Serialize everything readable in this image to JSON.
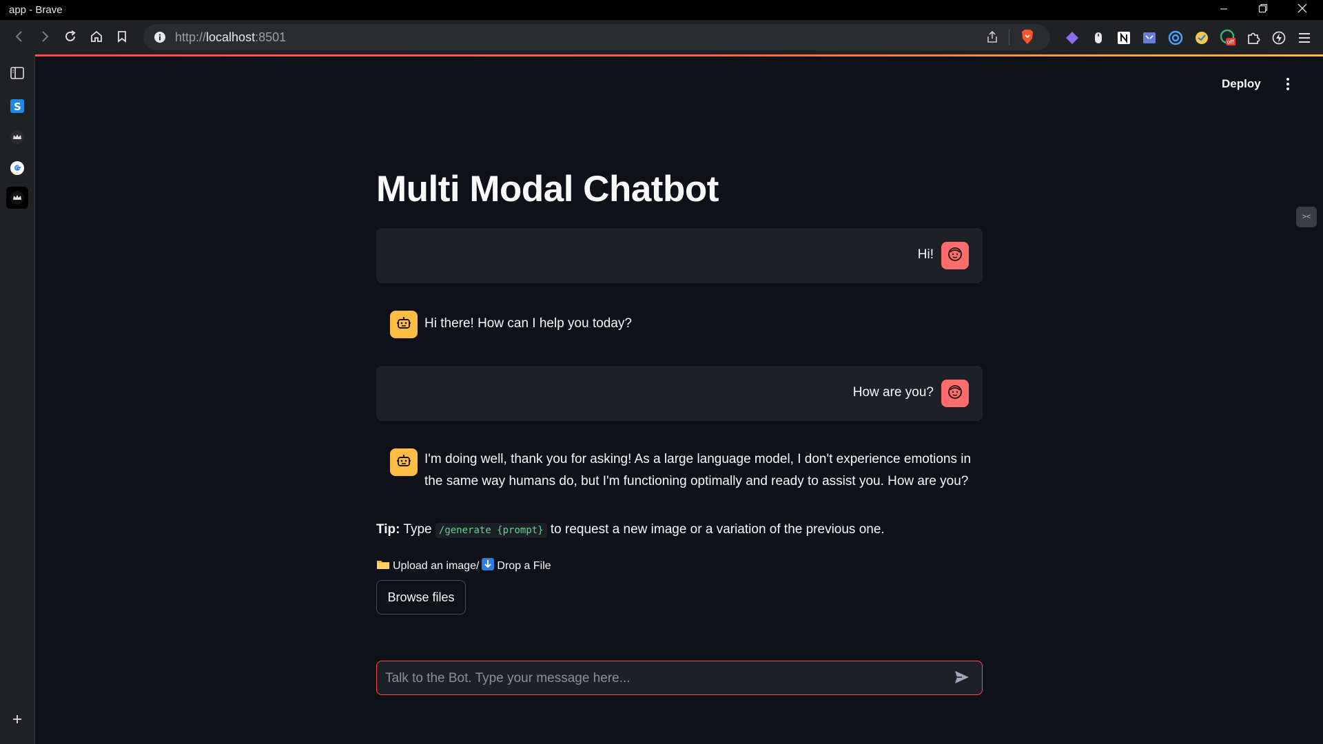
{
  "window": {
    "title": "app - Brave"
  },
  "browser": {
    "url_scheme": "http://",
    "url_host": "localhost",
    "url_port": ":8501"
  },
  "app": {
    "deploy_label": "Deploy",
    "title": "Multi Modal Chatbot",
    "messages": [
      {
        "role": "user",
        "text": "Hi!"
      },
      {
        "role": "assistant",
        "text": "Hi there! How can I help you today?"
      },
      {
        "role": "user",
        "text": "How are you?"
      },
      {
        "role": "assistant",
        "line1": "I'm doing well, thank you for asking! As a large language model, I don't experience emotions in",
        "line2": "the same way humans do, but I'm functioning optimally and ready to assist you. How are you?"
      }
    ],
    "tip": {
      "label": "Tip:",
      "before": " Type ",
      "code": "/generate {prompt}",
      "after": " to request a new image or a variation of the previous one."
    },
    "upload": {
      "part1": "Upload an image/",
      "part2": "Drop a File",
      "browse_label": "Browse files"
    },
    "chat_input": {
      "placeholder": "Talk to the Bot. Type your message here..."
    }
  },
  "colors": {
    "background": "#0e1117",
    "accent": "#ff4b4b",
    "user_avatar": "#ff6c6c",
    "bot_avatar": "#ffbd45",
    "code": "#5ed48b"
  }
}
